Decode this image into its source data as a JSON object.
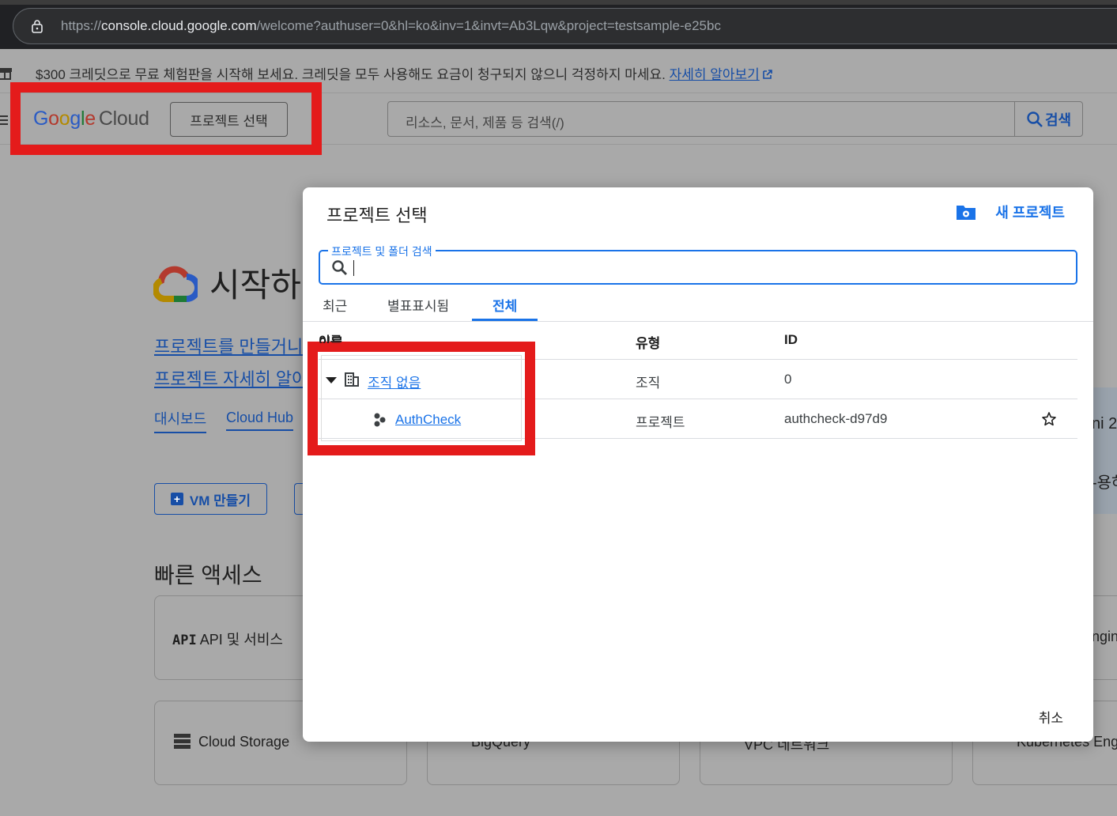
{
  "browser": {
    "url_prefix": "https://",
    "url_host": "console.cloud.google.com",
    "url_path": "/welcome?authuser=0&hl=ko&inv=1&invt=Ab3Lqw&project=testsample-e25bc"
  },
  "promo": {
    "text": "$300 크레딧으로 무료 체험판을 시작해 보세요. 크레딧을 모두 사용해도 요금이 청구되지 않으니 걱정하지 마세요. ",
    "link": "자세히 알아보기"
  },
  "header": {
    "logo_google": [
      "G",
      "o",
      "o",
      "g",
      "l",
      "e"
    ],
    "logo_cloud": "Cloud",
    "project_select": "프로젝트 선택",
    "search_placeholder": "리소스, 문서, 제품 등 검색(/)",
    "search_button": "검색"
  },
  "welcome": {
    "title": "시작하",
    "link1": "프로젝트를 만들거니",
    "link2": "프로젝트 자세히 알아",
    "tab1": "대시보드",
    "tab2": "Cloud Hub",
    "vm_button": "VM 만들기",
    "quick_access": "빠른 액세스",
    "card_api": "API 및 서비스",
    "card_storage": "Cloud Storage",
    "card_bigquery": "BigQuery",
    "card_vpc": "VPC 네트워크",
    "card_k8s": "Kubernetes Eng",
    "right_text1": "ni 2",
    "right_text2": "-용하",
    "right_text3": "ngin"
  },
  "dialog": {
    "title": "프로젝트 선택",
    "new_project": "새 프로젝트",
    "search_legend": "프로젝트 및 폴더 검색",
    "tabs": [
      "최근",
      "별표표시됨",
      "전체"
    ],
    "active_tab": "전체",
    "columns": {
      "name": "이름",
      "type": "유형",
      "id": "ID"
    },
    "rows": [
      {
        "name": "조직 없음",
        "type": "조직",
        "id": "0"
      },
      {
        "name": "AuthCheck",
        "type": "프로젝트",
        "id": "authcheck-d97d9"
      }
    ],
    "cancel": "취소"
  }
}
